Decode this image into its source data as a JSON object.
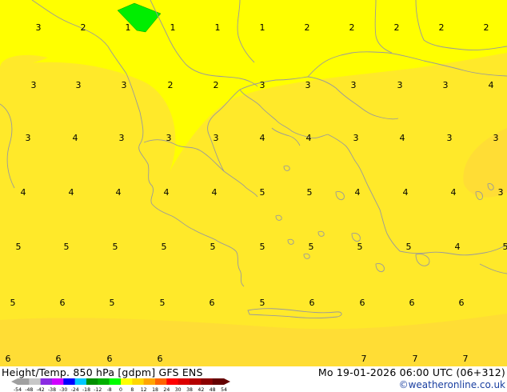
{
  "footer": {
    "title": "Height/Temp. 850 hPa [gdpm] GFS ENS",
    "valid_time": "Mo 19-01-2026 06:00 UTC (06+312)",
    "credit": "©weatheronline.co.uk"
  },
  "colors": {
    "background_temp_1_4": "#ffff00",
    "temp_5_6": "#ffe92a",
    "temp_7": "#ffdd35",
    "above_zero_highlight": "#00ee00",
    "coastline": "#9a9a9a"
  },
  "colorbar": {
    "ticks": [
      "-54",
      "-48",
      "-42",
      "-38",
      "-30",
      "-24",
      "-18",
      "-12",
      "-8",
      "0",
      "8",
      "12",
      "18",
      "24",
      "30",
      "38",
      "42",
      "48",
      "54"
    ],
    "colors": [
      "#a0a0a0",
      "#c8c8c8",
      "#8a2be2",
      "#d000ff",
      "#0000ff",
      "#00c8ff",
      "#009000",
      "#00b000",
      "#00ff00",
      "#ffff00",
      "#ffd700",
      "#ffa500",
      "#ff6400",
      "#ff0000",
      "#dc0000",
      "#b40000",
      "#8c0000",
      "#640000"
    ]
  },
  "map_labels": [
    {
      "text": "3",
      "col": 0,
      "row": 0
    },
    {
      "text": "2",
      "col": 1,
      "row": 0
    },
    {
      "text": "1",
      "col": 2,
      "row": 0
    },
    {
      "text": "1",
      "col": 3,
      "row": 0
    },
    {
      "text": "1",
      "col": 4,
      "row": 0
    },
    {
      "text": "1",
      "col": 5,
      "row": 0
    },
    {
      "text": "2",
      "col": 6,
      "row": 0
    },
    {
      "text": "2",
      "col": 7,
      "row": 0
    },
    {
      "text": "2",
      "col": 8,
      "row": 0
    },
    {
      "text": "2",
      "col": 9,
      "row": 0
    },
    {
      "text": "2",
      "col": 10,
      "row": 0
    },
    {
      "text": "3",
      "col": 0,
      "row": 1
    },
    {
      "text": "3",
      "col": 1,
      "row": 1
    },
    {
      "text": "3",
      "col": 2,
      "row": 1
    },
    {
      "text": "2",
      "col": 3,
      "row": 1
    },
    {
      "text": "2",
      "col": 4,
      "row": 1
    },
    {
      "text": "3",
      "col": 5,
      "row": 1
    },
    {
      "text": "3",
      "col": 6,
      "row": 1
    },
    {
      "text": "3",
      "col": 7,
      "row": 1
    },
    {
      "text": "3",
      "col": 8,
      "row": 1
    },
    {
      "text": "3",
      "col": 9,
      "row": 1
    },
    {
      "text": "4",
      "col": 10,
      "row": 1
    },
    {
      "text": "3",
      "col": 0,
      "row": 2
    },
    {
      "text": "4",
      "col": 1,
      "row": 2
    },
    {
      "text": "3",
      "col": 2,
      "row": 2
    },
    {
      "text": "3",
      "col": 3,
      "row": 2
    },
    {
      "text": "3",
      "col": 4,
      "row": 2
    },
    {
      "text": "4",
      "col": 5,
      "row": 2
    },
    {
      "text": "4",
      "col": 6,
      "row": 2
    },
    {
      "text": "3",
      "col": 7,
      "row": 2
    },
    {
      "text": "4",
      "col": 8,
      "row": 2
    },
    {
      "text": "3",
      "col": 9,
      "row": 2
    },
    {
      "text": "3",
      "col": 10,
      "row": 2
    },
    {
      "text": "4",
      "col": 0,
      "row": 3
    },
    {
      "text": "4",
      "col": 1,
      "row": 3
    },
    {
      "text": "4",
      "col": 2,
      "row": 3
    },
    {
      "text": "4",
      "col": 3,
      "row": 3
    },
    {
      "text": "4",
      "col": 4,
      "row": 3
    },
    {
      "text": "5",
      "col": 5,
      "row": 3
    },
    {
      "text": "5",
      "col": 6,
      "row": 3
    },
    {
      "text": "4",
      "col": 7,
      "row": 3
    },
    {
      "text": "4",
      "col": 8,
      "row": 3
    },
    {
      "text": "4",
      "col": 9,
      "row": 3
    },
    {
      "text": "3",
      "col": 10,
      "row": 3
    },
    {
      "text": "5",
      "col": 0,
      "row": 4
    },
    {
      "text": "5",
      "col": 1,
      "row": 4
    },
    {
      "text": "5",
      "col": 2,
      "row": 4
    },
    {
      "text": "5",
      "col": 3,
      "row": 4
    },
    {
      "text": "5",
      "col": 4,
      "row": 4
    },
    {
      "text": "5",
      "col": 5,
      "row": 4
    },
    {
      "text": "5",
      "col": 6,
      "row": 4
    },
    {
      "text": "5",
      "col": 7,
      "row": 4
    },
    {
      "text": "5",
      "col": 8,
      "row": 4
    },
    {
      "text": "4",
      "col": 9,
      "row": 4
    },
    {
      "text": "5",
      "col": 10,
      "row": 4
    },
    {
      "text": "5",
      "col": 0,
      "row": 5
    },
    {
      "text": "6",
      "col": 1,
      "row": 5
    },
    {
      "text": "5",
      "col": 2,
      "row": 5
    },
    {
      "text": "5",
      "col": 3,
      "row": 5
    },
    {
      "text": "6",
      "col": 4,
      "row": 5
    },
    {
      "text": "5",
      "col": 5,
      "row": 5
    },
    {
      "text": "6",
      "col": 6,
      "row": 5
    },
    {
      "text": "6",
      "col": 7,
      "row": 5
    },
    {
      "text": "6",
      "col": 8,
      "row": 5
    },
    {
      "text": "6",
      "col": 9,
      "row": 5
    },
    {
      "text": "6",
      "col": 0,
      "row": 6
    },
    {
      "text": "6",
      "col": 1,
      "row": 6
    },
    {
      "text": "6",
      "col": 2,
      "row": 6
    },
    {
      "text": "6",
      "col": 3,
      "row": 6
    },
    {
      "text": "7",
      "col": 7,
      "row": 6
    },
    {
      "text": "7",
      "col": 8,
      "row": 6
    },
    {
      "text": "7",
      "col": 9,
      "row": 6
    }
  ]
}
